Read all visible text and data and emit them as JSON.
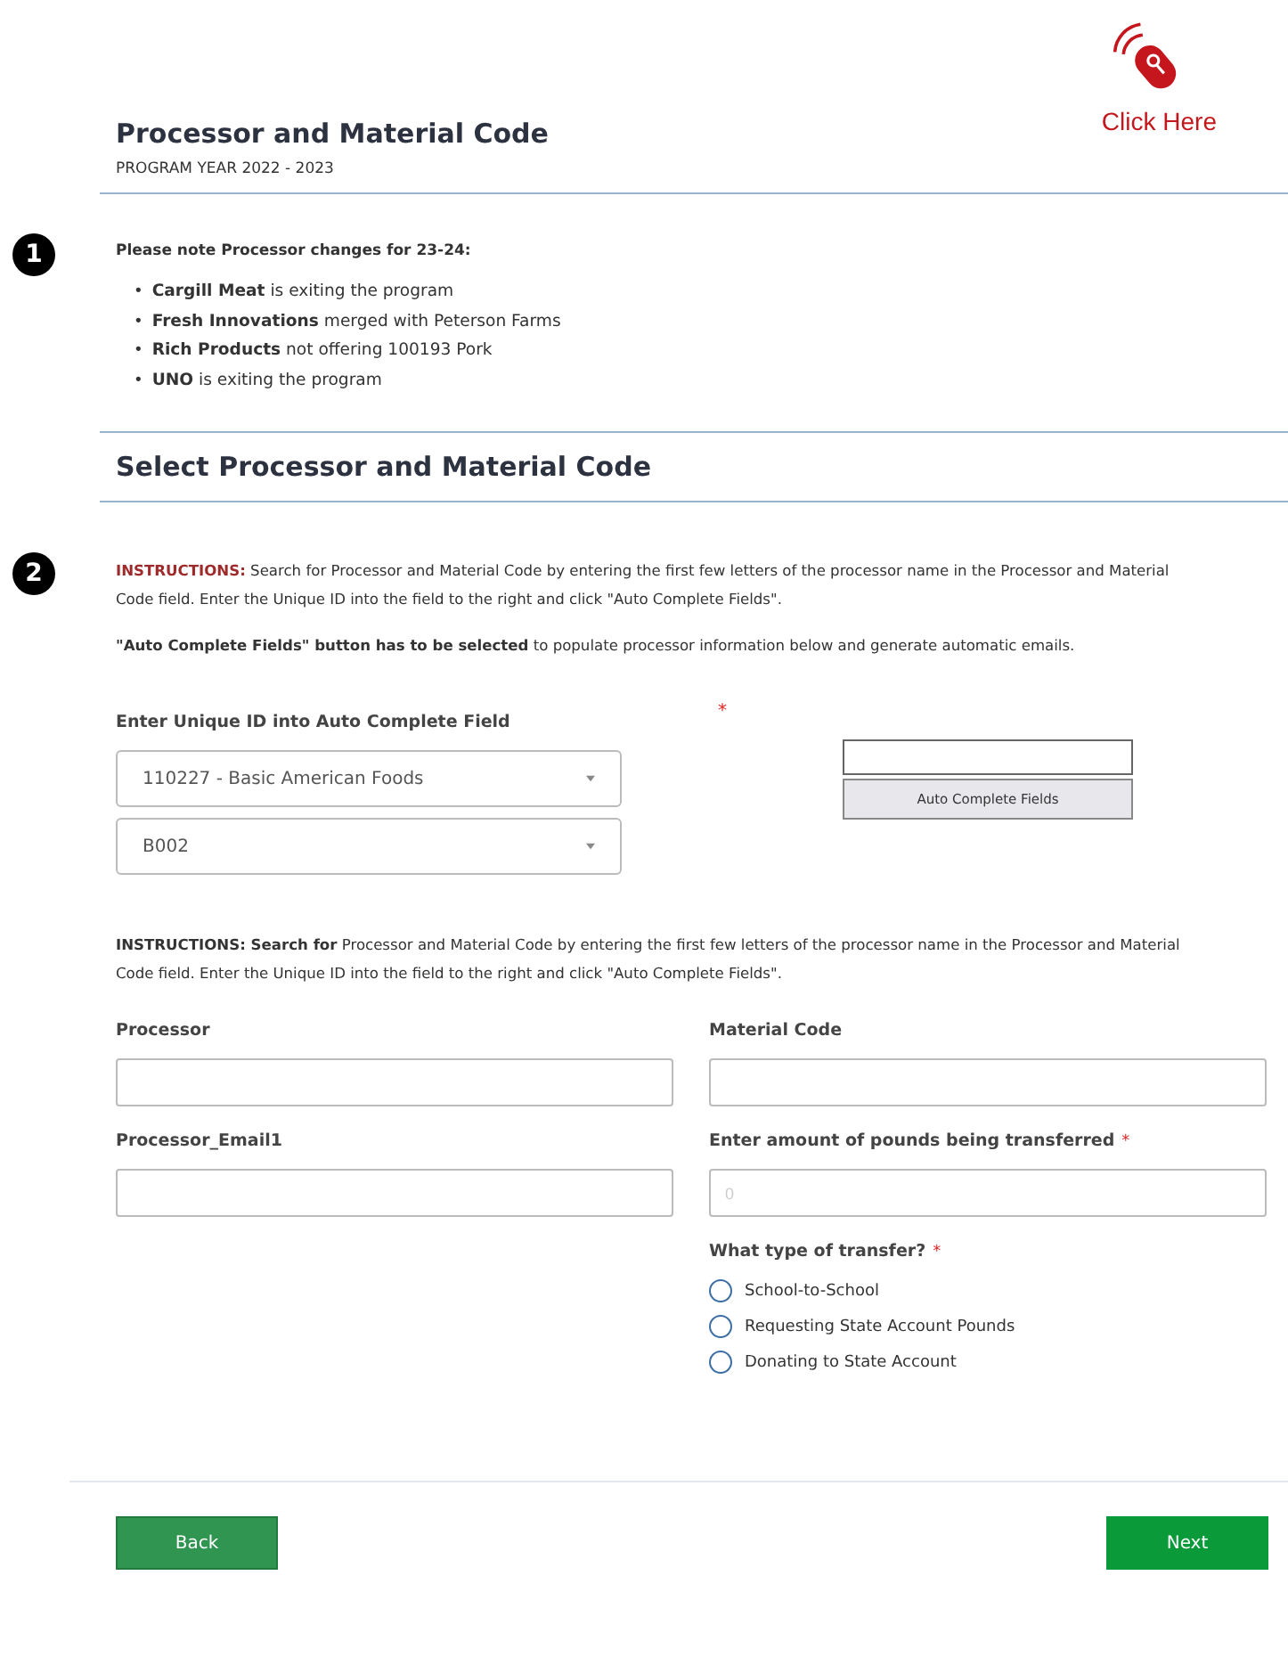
{
  "header": {
    "title": "Processor and Material Code",
    "subtitle": "PROGRAM YEAR 2022 - 2023",
    "click_here": "Click Here"
  },
  "notice": {
    "marker": "1",
    "bullet": "•",
    "heading": "Please note Processor changes for 23-24:",
    "items": [
      "**Cargill Meat** is exiting the program",
      "**Fresh Innovations** merged with Peterson Farms",
      "**Rich Products** not offering 100193 Pork",
      "**UNO** is exiting the program"
    ]
  },
  "section_title": "Select Processor and Material Code",
  "instructions": {
    "marker": "2",
    "paragraphs": [
      {
        "lead": "INSTRUCTIONS:",
        "kind": "alert",
        "text": "Search for Processor and Material Code by entering the first few letters of the processor name in the Processor and Material Code field. Enter the Unique ID into the field to the right and click \"Auto Complete Fields\"."
      },
      {
        "lead": "\"Auto Complete Fields\" button has to be selected",
        "kind": "plain",
        "text": "to populate processor information below and generate automatic emails."
      }
    ]
  },
  "unique_id": {
    "label": "Enter Unique ID into Auto Complete Field",
    "required_mark": "*",
    "selects": [
      "110227 - Basic American Foods",
      "B002"
    ],
    "button": "Auto Complete Fields"
  },
  "instructions_2": {
    "text": "**INSTRUCTIONS: Search for** Processor and Material Code by entering the first few letters of the processor name in the Processor and Material Code field. Enter the Unique ID into the field to the right and click \"Auto Complete Fields\"."
  },
  "fields": [
    {
      "label": "Processor"
    },
    {
      "label": "Material Code"
    },
    {
      "label": "Processor_Email1"
    },
    {
      "label": "Enter amount of pounds being transferred",
      "required_mark": "*",
      "placeholder": "0"
    }
  ],
  "transfer": {
    "question": "What type of transfer?",
    "required_mark": "*",
    "options": [
      {
        "label": "School-to-School",
        "selected": false
      },
      {
        "label": "Requesting State Account Pounds",
        "selected": false
      },
      {
        "label": "Donating to State Account",
        "selected": false
      }
    ]
  },
  "buttons": {
    "back": "Back",
    "next": "Next"
  }
}
